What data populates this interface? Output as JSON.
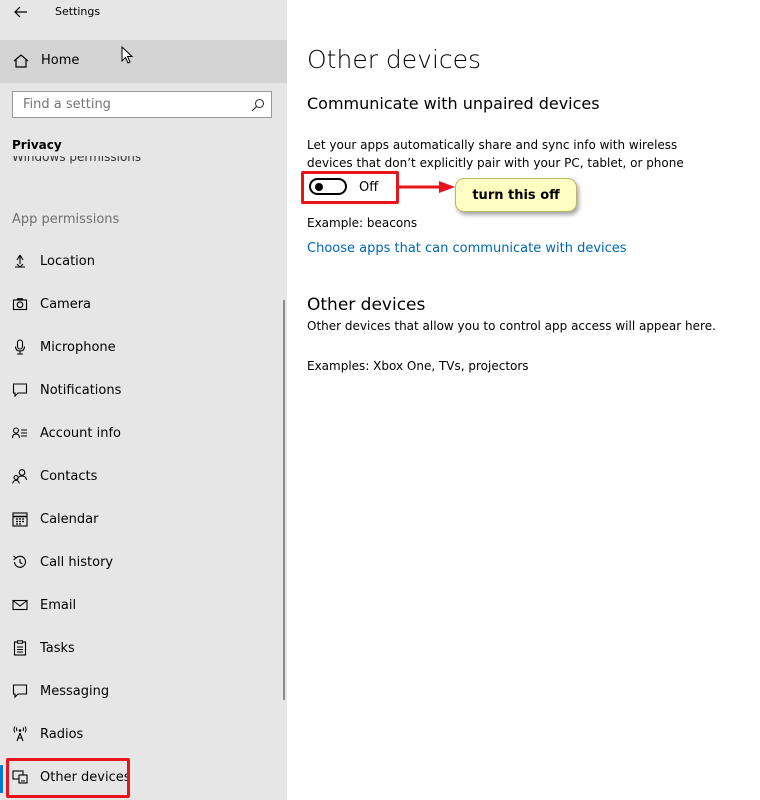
{
  "app": {
    "title": "Settings"
  },
  "sidebar": {
    "home_label": "Home",
    "search_placeholder": "Find a setting",
    "section_privacy": "Privacy",
    "clipped_item": "Windows permissions",
    "section_app_permissions": "App permissions",
    "items": [
      {
        "label": "Location",
        "icon": "location-icon"
      },
      {
        "label": "Camera",
        "icon": "camera-icon"
      },
      {
        "label": "Microphone",
        "icon": "microphone-icon"
      },
      {
        "label": "Notifications",
        "icon": "notifications-icon"
      },
      {
        "label": "Account info",
        "icon": "account-info-icon"
      },
      {
        "label": "Contacts",
        "icon": "contacts-icon"
      },
      {
        "label": "Calendar",
        "icon": "calendar-icon"
      },
      {
        "label": "Call history",
        "icon": "call-history-icon"
      },
      {
        "label": "Email",
        "icon": "email-icon"
      },
      {
        "label": "Tasks",
        "icon": "tasks-icon"
      },
      {
        "label": "Messaging",
        "icon": "messaging-icon"
      },
      {
        "label": "Radios",
        "icon": "radios-icon"
      },
      {
        "label": "Other devices",
        "icon": "other-devices-icon",
        "selected": true
      }
    ]
  },
  "main": {
    "title": "Other devices",
    "subheading": "Communicate with unpaired devices",
    "description": "Let your apps automatically share and sync info with wireless devices that don’t explicitly pair with your PC, tablet, or phone",
    "toggle_state": "Off",
    "callout": "turn this off",
    "example": "Example: beacons",
    "link": "Choose apps that can communicate with devices",
    "heading2": "Other devices",
    "description2": "Other devices that allow you to control app access will appear here.",
    "example2": "Examples: Xbox One, TVs, projectors"
  },
  "colors": {
    "sidebar_bg": "#e6e6e6",
    "accent": "#0078d7",
    "link": "#0067b8",
    "annotation_red": "#e8131b",
    "callout_bg": "#ffffc4"
  }
}
